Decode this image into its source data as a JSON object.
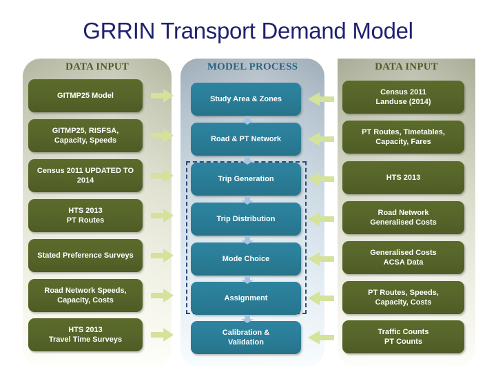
{
  "slide": {
    "title": "GRRIN Transport Demand Model",
    "title_color": "#1f2170",
    "background": "#ffffff"
  },
  "columns": {
    "left": {
      "header": "DATA INPUT",
      "header_color": "#515b2c",
      "box_color": "#55632a",
      "items": [
        {
          "lines": [
            "GITMP25 Model"
          ]
        },
        {
          "lines": [
            "GITMP25, RISFSA,",
            "Capacity, Speeds"
          ]
        },
        {
          "lines": [
            "Census 2011 UPDATED TO",
            "2014"
          ]
        },
        {
          "lines": [
            "HTS 2013",
            "PT Routes"
          ]
        },
        {
          "lines": [
            "Stated Preference Surveys"
          ]
        },
        {
          "lines": [
            "Road Network Speeds,",
            "Capacity, Costs"
          ]
        },
        {
          "lines": [
            "HTS 2013",
            "Travel Time Surveys"
          ]
        }
      ]
    },
    "middle": {
      "header": "MODEL PROCESS",
      "header_color": "#2e6480",
      "box_color": "#2a7d97",
      "items": [
        {
          "lines": [
            "Study Area & Zones"
          ]
        },
        {
          "lines": [
            "Road & PT Network"
          ]
        },
        {
          "lines": [
            "Trip Generation"
          ]
        },
        {
          "lines": [
            "Trip Distribution"
          ]
        },
        {
          "lines": [
            "Mode Choice"
          ]
        },
        {
          "lines": [
            "Assignment"
          ]
        },
        {
          "lines": [
            "Calibration &",
            "Validation"
          ]
        }
      ]
    },
    "right": {
      "header": "DATA INPUT",
      "header_color": "#515b2c",
      "box_color": "#55632a",
      "items": [
        {
          "lines": [
            "Census 2011",
            "Landuse (2014)"
          ]
        },
        {
          "lines": [
            "PT Routes, Timetables,",
            "Capacity, Fares"
          ]
        },
        {
          "lines": [
            "HTS 2013"
          ]
        },
        {
          "lines": [
            "Road Network",
            "Generalised Costs"
          ]
        },
        {
          "lines": [
            "Generalised Costs",
            "ACSA Data"
          ]
        },
        {
          "lines": [
            "PT Routes, Speeds,",
            "Capacity, Costs"
          ]
        },
        {
          "lines": [
            "Traffic Counts",
            "PT Counts"
          ]
        }
      ]
    }
  },
  "connectors": {
    "horizontal_arrow_color": "#d4e29a",
    "vertical_arrow_color": "#a8c4e0",
    "dashed_group_color": "#2b4a7e",
    "dashed_group_members": [
      "Trip Generation",
      "Trip Distribution",
      "Mode Choice",
      "Assignment"
    ]
  }
}
